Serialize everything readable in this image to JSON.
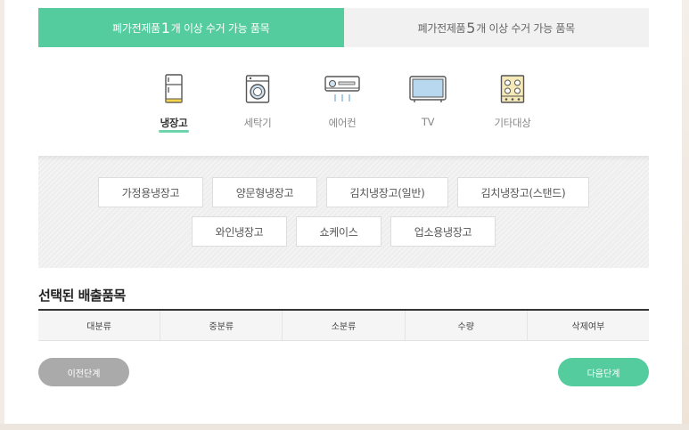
{
  "tabs": [
    {
      "prefix": "폐가전제품 ",
      "number": "1",
      "suffix": "개 이상 수거 가능 품목",
      "active": true
    },
    {
      "prefix": "폐가전제품 ",
      "number": "5",
      "suffix": "개 이상 수거 가능 품목",
      "active": false
    }
  ],
  "categories": [
    {
      "label": "냉장고",
      "icon": "refrigerator-icon",
      "active": true
    },
    {
      "label": "세탁기",
      "icon": "washing-machine-icon",
      "active": false
    },
    {
      "label": "에어컨",
      "icon": "air-conditioner-icon",
      "active": false
    },
    {
      "label": "TV",
      "icon": "tv-icon",
      "active": false
    },
    {
      "label": "기타대상",
      "icon": "etc-appliance-icon",
      "active": false
    }
  ],
  "sub_items": [
    "가정용냉장고",
    "양문형냉장고",
    "김치냉장고(일반)",
    "김치냉장고(스탠드)",
    "와인냉장고",
    "쇼케이스",
    "업소용냉장고"
  ],
  "selected": {
    "title": "선택된 배출품목",
    "columns": [
      "대분류",
      "중분류",
      "소분류",
      "수량",
      "삭제여부"
    ]
  },
  "buttons": {
    "prev": "이전단계",
    "next": "다음단계"
  },
  "colors": {
    "accent": "#55cc9e",
    "inactive_tab": "#f1f1f1",
    "prev_button": "#aaaaaa"
  }
}
